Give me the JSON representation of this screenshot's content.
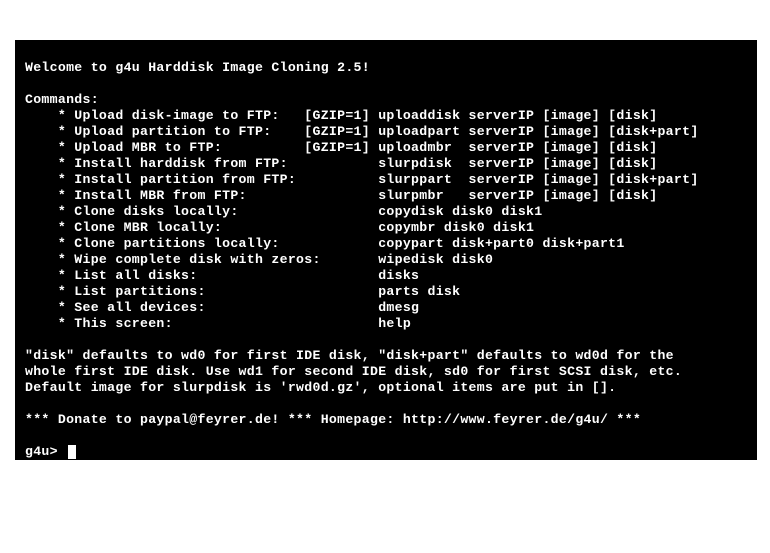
{
  "welcome": "Welcome to g4u Harddisk Image Cloning 2.5!",
  "commands_header": "Commands:",
  "commands": [
    "    * Upload disk-image to FTP:   [GZIP=1] uploaddisk serverIP [image] [disk]",
    "    * Upload partition to FTP:    [GZIP=1] uploadpart serverIP [image] [disk+part]",
    "    * Upload MBR to FTP:          [GZIP=1] uploadmbr  serverIP [image] [disk]",
    "    * Install harddisk from FTP:           slurpdisk  serverIP [image] [disk]",
    "    * Install partition from FTP:          slurppart  serverIP [image] [disk+part]",
    "    * Install MBR from FTP:                slurpmbr   serverIP [image] [disk]",
    "    * Clone disks locally:                 copydisk disk0 disk1",
    "    * Clone MBR locally:                   copymbr disk0 disk1",
    "    * Clone partitions locally:            copypart disk+part0 disk+part1",
    "    * Wipe complete disk with zeros:       wipedisk disk0",
    "    * List all disks:                      disks",
    "    * List partitions:                     parts disk",
    "    * See all devices:                     dmesg",
    "    * This screen:                         help"
  ],
  "note1": "\"disk\" defaults to wd0 for first IDE disk, \"disk+part\" defaults to wd0d for the",
  "note2": "whole first IDE disk. Use wd1 for second IDE disk, sd0 for first SCSI disk, etc.",
  "note3": "Default image for slurpdisk is 'rwd0d.gz', optional items are put in [].",
  "donate": "*** Donate to paypal@feyrer.de! *** Homepage: http://www.feyrer.de/g4u/ ***",
  "prompt": "g4u> "
}
